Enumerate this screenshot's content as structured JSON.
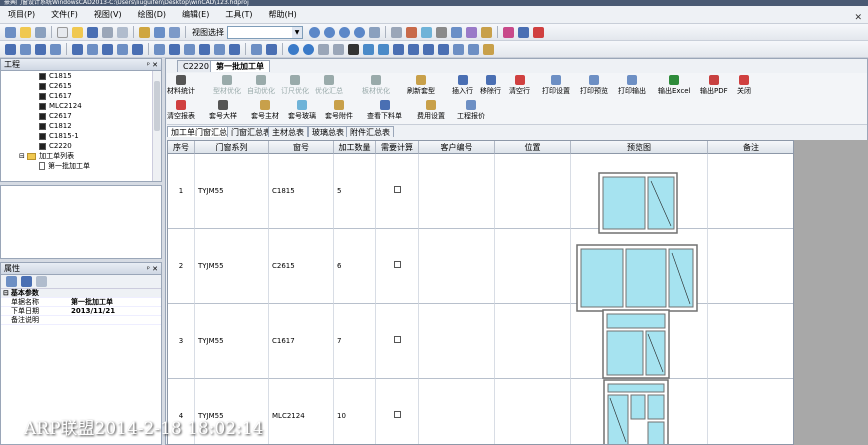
{
  "window": {
    "title": "豪典门窗设计系统WindowsCAD2013-C:\\Users\\liuguifen\\Desktop\\winCAD\\123.hdproj"
  },
  "menu": [
    "项目(P)",
    "文件(F)",
    "视图(V)",
    "绘图(D)",
    "编辑(E)",
    "工具(T)",
    "帮助(H)"
  ],
  "toolbar": {
    "view_select_label": "视图选择",
    "view_select_value": ""
  },
  "project_panel": {
    "title": "工程",
    "tree": [
      "C1815",
      "C2615",
      "C1617",
      "MLC2124",
      "C2617",
      "C1812",
      "C1815-1",
      "C2220"
    ],
    "list_folder": "加工单列表",
    "list_item": "第一批加工单"
  },
  "props_panel": {
    "title": "属性",
    "group": "基本参数",
    "rows": [
      {
        "k": "单据名称",
        "v": "第一批加工单"
      },
      {
        "k": "下单日期",
        "v": "2013/11/21"
      },
      {
        "k": "备注说明",
        "v": ""
      }
    ]
  },
  "doc_tabs": [
    "C2220",
    "第一批加工单"
  ],
  "ribbon_row1": [
    "材料统计",
    "型材优化",
    "自动优化",
    "订尺优化",
    "优化汇总",
    "板材优化",
    "刷新套型",
    "插入行",
    "移除行",
    "清空行",
    "打印设置",
    "打印预览",
    "打印输出",
    "输出Excel",
    "输出PDF",
    "关闭"
  ],
  "ribbon_row2": [
    "清空报表",
    "套号大样",
    "套号主材",
    "套号玻璃",
    "套号附件",
    "查看下料单",
    "费用设置",
    "工程报价"
  ],
  "sub_tabs": [
    "加工单",
    "门窗汇总",
    "门窗汇总表",
    "主材总表",
    "玻璃总表",
    "附件汇总表"
  ],
  "table": {
    "headers": [
      "序号",
      "门窗系列",
      "窗号",
      "加工数量",
      "需要计算",
      "客户编号",
      "位置",
      "预览图",
      "备注"
    ],
    "rows": [
      {
        "no": "1",
        "series": "TYJM55",
        "code": "C1815",
        "qty": "5"
      },
      {
        "no": "2",
        "series": "TYJM55",
        "code": "C2615",
        "qty": "6"
      },
      {
        "no": "3",
        "series": "TYJM55",
        "code": "C1617",
        "qty": "7"
      },
      {
        "no": "4",
        "series": "TYJM55",
        "code": "MLC2124",
        "qty": "10"
      }
    ]
  },
  "watermark": "ARP联盟2014-2-18 18:02:14",
  "colors": {
    "glass": "#a6e3f0",
    "frame": "#707070",
    "accent": "#4a5a73"
  }
}
